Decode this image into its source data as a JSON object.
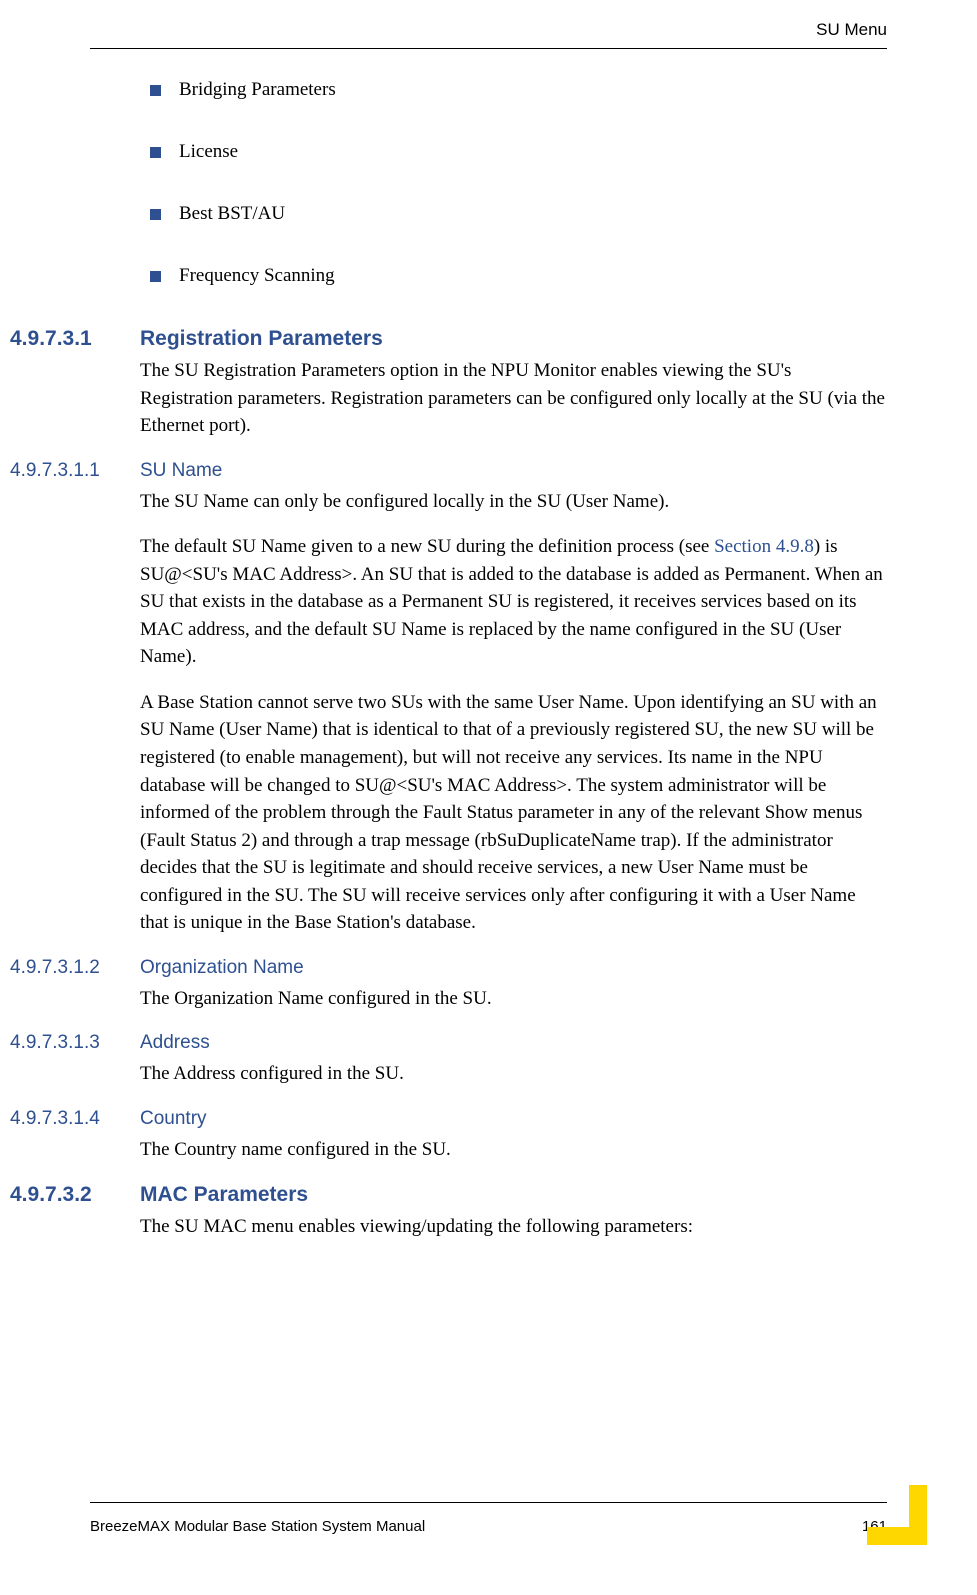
{
  "header": {
    "title": "SU Menu"
  },
  "bullets": [
    "Bridging Parameters",
    "License",
    "Best BST/AU",
    "Frequency Scanning"
  ],
  "sections": {
    "s1": {
      "number": "4.9.7.3.1",
      "title": "Registration Parameters",
      "body": "The SU Registration Parameters option in the NPU Monitor enables viewing the SU's Registration parameters. Registration parameters can be configured only locally at the SU (via the Ethernet port)."
    },
    "s1_1": {
      "number": "4.9.7.3.1.1",
      "title": "SU Name",
      "body1": "The SU Name can only be configured locally in the SU (User Name).",
      "body2_pre": "The default SU Name given to a new SU during the definition process (see ",
      "body2_link": "Section 4.9.8",
      "body2_post": ") is SU@<SU's MAC Address>. An SU that is added to the database is added as Permanent. When an SU that exists in the database as a Permanent SU is registered, it receives services based on its MAC address, and the default SU Name is replaced by the name configured in the SU (User Name).",
      "body3": "A Base Station cannot serve two SUs with the same User Name. Upon identifying an SU with an SU Name (User Name) that is identical to that of a previously registered SU, the new SU will be registered (to enable management), but will not receive any services. Its name in the NPU database will be changed to SU@<SU's MAC Address>. The system administrator will be informed of the problem through the Fault Status parameter in any of the relevant Show menus (Fault Status 2) and through a trap message (rbSuDuplicateName trap). If the administrator decides that the SU is legitimate and should receive services, a new User Name must be configured in the SU. The SU will receive services only after configuring it with a User Name that is unique in the Base Station's database."
    },
    "s1_2": {
      "number": "4.9.7.3.1.2",
      "title": "Organization Name",
      "body": "The Organization Name configured in the SU."
    },
    "s1_3": {
      "number": "4.9.7.3.1.3",
      "title": "Address",
      "body": "The Address configured in the SU."
    },
    "s1_4": {
      "number": "4.9.7.3.1.4",
      "title": "Country",
      "body": "The Country name configured in the SU."
    },
    "s2": {
      "number": "4.9.7.3.2",
      "title": "MAC Parameters",
      "body": "The SU MAC menu enables viewing/updating the following parameters:"
    }
  },
  "footer": {
    "left": "BreezeMAX Modular Base Station System Manual",
    "right": "161"
  }
}
